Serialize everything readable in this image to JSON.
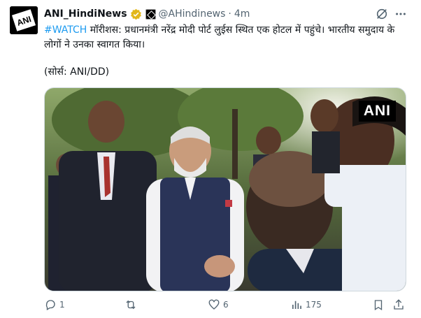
{
  "tweet": {
    "display_name": "ANI_HindiNews",
    "handle": "@AHindinews",
    "separator": "·",
    "time": "4m",
    "hashtag": "#WATCH",
    "text_body": " मॉरीशस: प्रधानमंत्री नरेंद्र मोदी पोर्ट लुईस स्थित एक होटल में पहुंचे। भारतीय समुदाय के लोगों ने उनका स्वागत किया।",
    "source": "(सोर्स: ANI/DD)",
    "avatar_text": "ANI",
    "media_watermark": "ANI"
  },
  "actions": {
    "reply_count": "1",
    "repost_count": "",
    "like_count": "6",
    "views_count": "175"
  },
  "colors": {
    "accent": "#1d9bf0",
    "text": "#0f1419",
    "muted": "#536471",
    "verified_gold": "#e2b719"
  },
  "icons": [
    "grok-icon",
    "more-icon",
    "verified-badge-icon",
    "affiliate-badge-icon",
    "reply-icon",
    "repost-icon",
    "like-icon",
    "views-icon",
    "bookmark-icon",
    "share-icon"
  ]
}
